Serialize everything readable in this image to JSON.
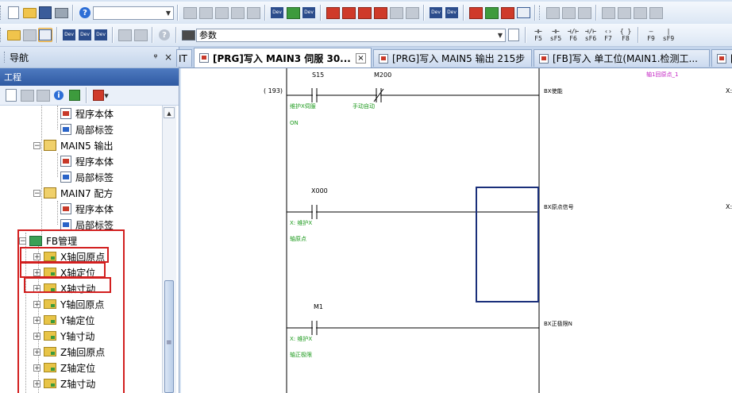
{
  "toolbar1": {
    "combo_value": "",
    "icons": [
      "new-icon",
      "open-icon",
      "save-icon",
      "print-icon",
      "help-icon",
      "cut-icon",
      "copy-icon",
      "paste-icon",
      "undo-icon",
      "redo-icon",
      "dev-icon",
      "dev-icon",
      "dev-icon",
      "write-icon",
      "read-icon",
      "verify-icon",
      "delete-icon",
      "compare-icon",
      "dev-icon",
      "dev-icon",
      "monitor-icon",
      "monitor-icon",
      "monitor-icon",
      "device-icon"
    ]
  },
  "toolbar2": {
    "ladder_keys": [
      "F5",
      "sF5",
      "F6",
      "sF6",
      "F7",
      "F8",
      "F9",
      "sF9"
    ],
    "param_combo": "参数"
  },
  "nav": {
    "title": "导航",
    "pin": "ᵠ",
    "close": "×",
    "project_header": "工程"
  },
  "tree": {
    "items": [
      {
        "label": "程序本体",
        "icon": "program-icon",
        "level": 3
      },
      {
        "label": "局部标签",
        "icon": "label-icon",
        "level": 3
      },
      {
        "label": "MAIN5 输出",
        "icon": "program-icon",
        "level": 2,
        "expand": "−"
      },
      {
        "label": "程序本体",
        "icon": "program-icon",
        "level": 3
      },
      {
        "label": "局部标签",
        "icon": "label-icon",
        "level": 3
      },
      {
        "label": "MAIN7 配方",
        "icon": "program-icon",
        "level": 2,
        "expand": "−"
      },
      {
        "label": "程序本体",
        "icon": "program-icon",
        "level": 3
      },
      {
        "label": "局部标签",
        "icon": "label-icon",
        "level": 3
      },
      {
        "label": "FB管理",
        "icon": "fb-root-icon",
        "level": 1,
        "expand": "−"
      },
      {
        "label": "X轴回原点",
        "icon": "fb-folder-icon",
        "level": 2,
        "expand": "+"
      },
      {
        "label": "X轴定位",
        "icon": "fb-folder-icon",
        "level": 2,
        "expand": "+"
      },
      {
        "label": "X轴寸动",
        "icon": "fb-folder-icon",
        "level": 2,
        "expand": "+"
      },
      {
        "label": "Y轴回原点",
        "icon": "fb-folder-icon",
        "level": 2,
        "expand": "+"
      },
      {
        "label": "Y轴定位",
        "icon": "fb-folder-icon",
        "level": 2,
        "expand": "+"
      },
      {
        "label": "Y轴寸动",
        "icon": "fb-folder-icon",
        "level": 2,
        "expand": "+"
      },
      {
        "label": "Z轴回原点",
        "icon": "fb-folder-icon",
        "level": 2,
        "expand": "+"
      },
      {
        "label": "Z轴定位",
        "icon": "fb-folder-icon",
        "level": 2,
        "expand": "+"
      },
      {
        "label": "Z轴寸动",
        "icon": "fb-folder-icon",
        "level": 2,
        "expand": "+"
      }
    ]
  },
  "tabs": [
    {
      "label": "IT",
      "active": false
    },
    {
      "label": "[PRG]写入 MAIN3 伺服 30...",
      "active": true,
      "close": "×"
    },
    {
      "label": "[PRG]写入 MAIN5 输出 215步",
      "active": false
    },
    {
      "label": "[FB]写入 单工位(MAIN1.检测工...",
      "active": false
    },
    {
      "label": "[",
      "active": false
    }
  ],
  "ladder": {
    "step": "( 193)",
    "rung1": {
      "c1_device": "S15",
      "c1_comment": "维护X伺服",
      "c1_state": "ON",
      "c2_device": "M200",
      "c2_comment": "手动自动",
      "fb_title": "轴1回原点_1",
      "fb_pin": "BX使能",
      "right": "X:"
    },
    "rung2": {
      "c1_device": "X000",
      "c1_comment1": "X: 维护X",
      "c1_comment2": "轴原点",
      "fb_pin": "BX原点信号",
      "right": "X:"
    },
    "rung3": {
      "c1_device": "M1",
      "c1_comment1": "X: 维护X",
      "c1_comment2": "轴正极限",
      "fb_pin": "BX正极限N"
    }
  }
}
